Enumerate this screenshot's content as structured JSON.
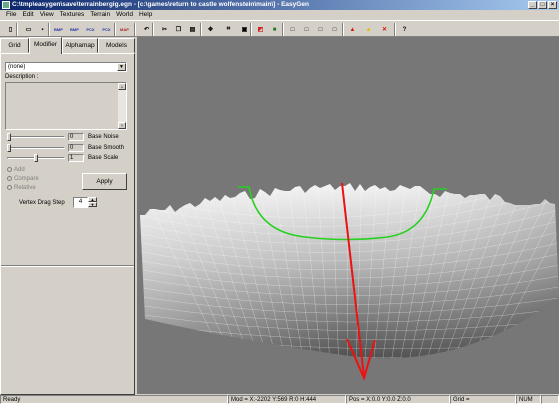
{
  "window": {
    "title": "C:\\tmp\\easygen\\save\\terrainbergig.egn - [c:\\games\\return to castle wolfenstein\\main\\] - EasyGen"
  },
  "menu": [
    "File",
    "Edit",
    "View",
    "Textures",
    "Terrain",
    "World",
    "Help"
  ],
  "toolbar": {
    "buttons": [
      {
        "name": "new-icon",
        "glyph": "▯"
      },
      {
        "name": "open-icon",
        "glyph": "▭"
      },
      {
        "name": "save-icon",
        "glyph": "▪"
      },
      {
        "name": "load-bmp-icon",
        "glyph": "BMP"
      },
      {
        "name": "save-bmp-icon",
        "glyph": "BMP"
      },
      {
        "name": "load-pcx-icon",
        "glyph": "PCX"
      },
      {
        "name": "save-pcx-icon",
        "glyph": "PCX"
      },
      {
        "name": "map-icon",
        "glyph": "MAP"
      },
      {
        "name": "undo-icon",
        "glyph": "↶"
      },
      {
        "name": "cut-icon",
        "glyph": "✂"
      },
      {
        "name": "copy-icon",
        "glyph": "❐"
      },
      {
        "name": "paste-icon",
        "glyph": "▤"
      },
      {
        "name": "tool-move-icon",
        "glyph": "✥"
      },
      {
        "name": "tool-grid-icon",
        "glyph": "⌗"
      },
      {
        "name": "tool-select-icon",
        "glyph": "▣"
      },
      {
        "name": "texture-flag-icon",
        "glyph": "◩"
      },
      {
        "name": "texture-green-icon",
        "glyph": "■"
      },
      {
        "name": "view-1-icon",
        "glyph": "□"
      },
      {
        "name": "view-2-icon",
        "glyph": "□"
      },
      {
        "name": "view-3-icon",
        "glyph": "□"
      },
      {
        "name": "view-4-icon",
        "glyph": "□"
      },
      {
        "name": "mod-red-icon",
        "glyph": "▲"
      },
      {
        "name": "mod-yellow-icon",
        "glyph": "▲"
      },
      {
        "name": "mod-cross-icon",
        "glyph": "✕"
      },
      {
        "name": "help-icon",
        "glyph": "?"
      }
    ]
  },
  "tabs": [
    {
      "label": "Grid",
      "active": false
    },
    {
      "label": "Modifier",
      "active": true
    },
    {
      "label": "Alphamap",
      "active": false
    },
    {
      "label": "Models",
      "active": false
    }
  ],
  "modifier": {
    "combo_value": "(none)",
    "description_label": "Description :",
    "sliders": [
      {
        "label": "Base Noise",
        "value": "0",
        "level": 0.0
      },
      {
        "label": "Base Smooth",
        "value": "0",
        "level": 0.0
      },
      {
        "label": "Base Scale",
        "value": "1",
        "level": 0.5
      }
    ],
    "radios": [
      "Add",
      "Compare",
      "Relative"
    ],
    "apply_label": "Apply",
    "vertex_drag_label": "Vertex Drag Step",
    "vertex_drag_value": "4"
  },
  "status": {
    "ready": "Ready",
    "mod": "Mod = X:-2202 Y:569 R:0 H:444",
    "pos": "Pos = X:0.0 Y:0.0 Z:0.0",
    "grid": "Grid =",
    "num": "NUM"
  },
  "colors": {
    "titlebar_start": "#0a246a",
    "titlebar_end": "#a6caf0",
    "viewport_bg": "#777777",
    "modifier_curve": "#27d11f",
    "axis_arrow": "#ee1111"
  }
}
